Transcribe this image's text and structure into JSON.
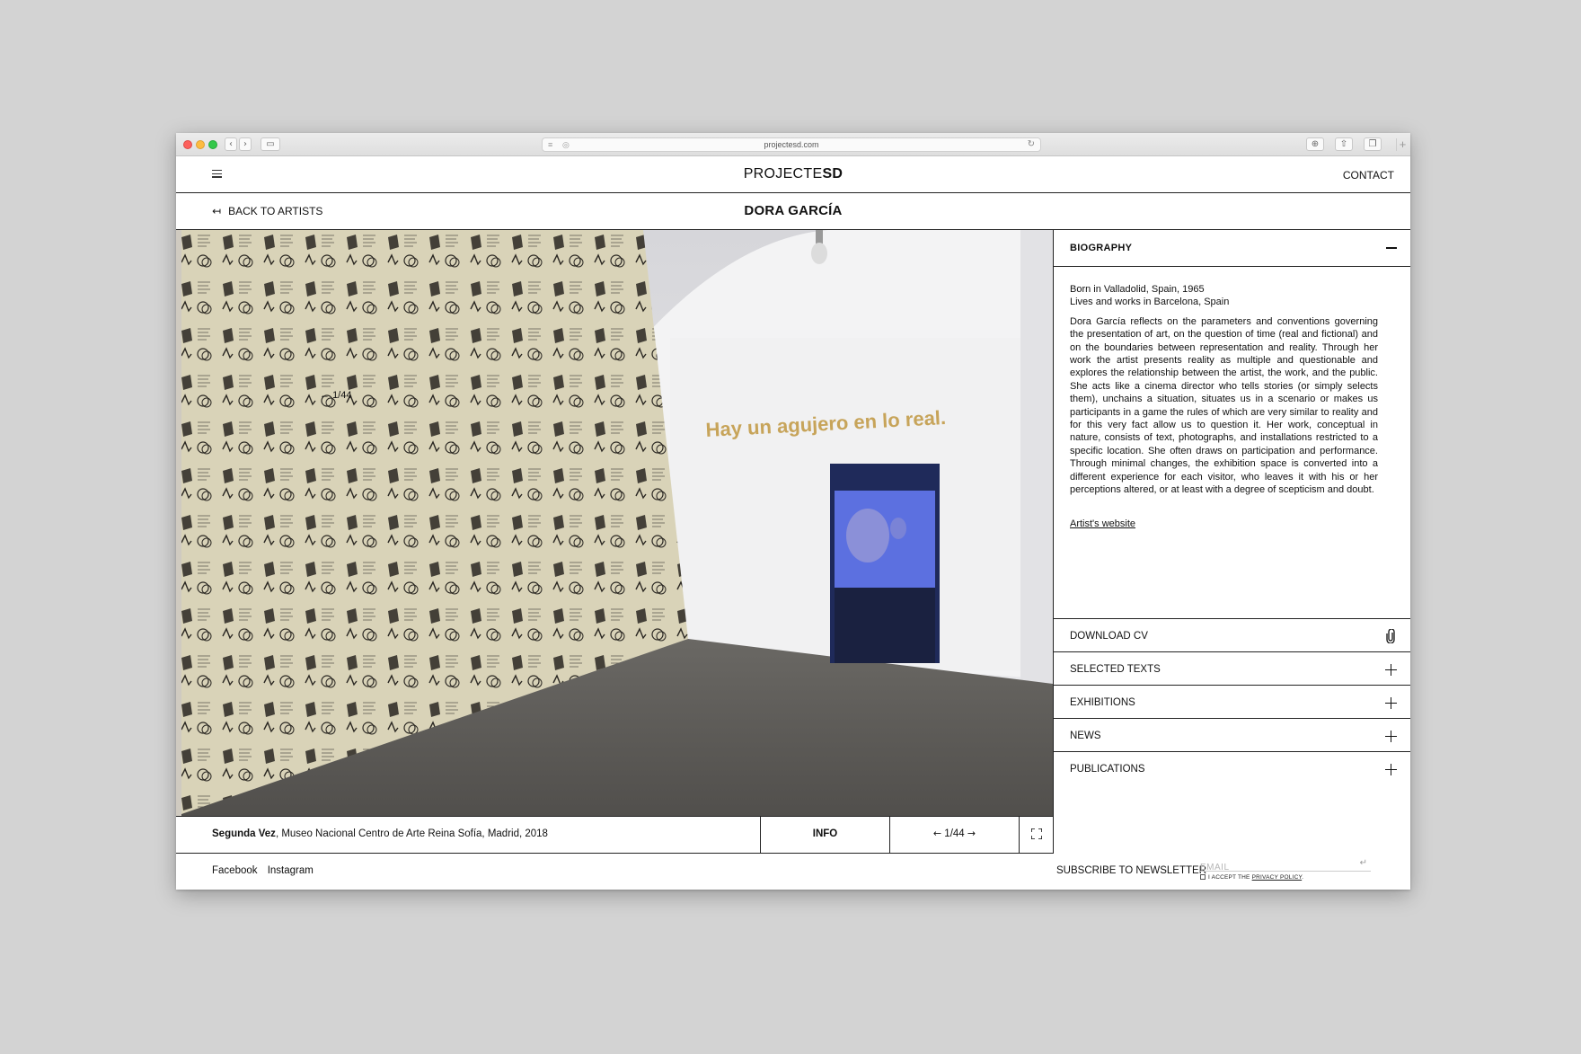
{
  "browser": {
    "url": "projectesd.com"
  },
  "header": {
    "logo_regular": "PROJECTE",
    "logo_bold": "SD",
    "contact": "CONTACT"
  },
  "subheader": {
    "back_label": "BACK TO ARTISTS",
    "artist_name": "DORA GARCÍA"
  },
  "gallery": {
    "overlay_counter": "1/44",
    "wall_text": "Hay un agujero en lo real."
  },
  "caption": {
    "title": "Segunda Vez",
    "rest": ", Museo Nacional Centro de Arte Reina Sofía, Madrid, 2018"
  },
  "controls": {
    "info": "INFO",
    "prev_arrow": "←",
    "counter": "1/44",
    "next_arrow": "→"
  },
  "sidebar": {
    "biography_title": "BIOGRAPHY",
    "born": "Born in Valladolid, Spain, 1965",
    "lives": "Lives and works in Barcelona, Spain",
    "bio_text": "Dora García reflects on the parameters and conventions governing the presentation of art, on the question of time (real and fictional) and on the boundaries between representation and reality. Through her work the artist presents reality as multiple and questionable and explores the relationship between the artist, the work, and the public. She acts like a cinema director who tells stories (or simply selects them), unchains a situation, situates us in a scenario or makes us participants in a game the rules of which are very similar to reality and for this very fact allow us to question it. Her work, conceptual in nature, consists of text, photographs, and installations restricted to a specific location. She often draws on participation and performance. Through minimal changes, the exhibition space is converted into a different experience for each visitor, who leaves it with his or her perceptions altered, or at least with a degree of scepticism and doubt.",
    "website_link": "Artist's website",
    "accordion": [
      {
        "label": "DOWNLOAD CV",
        "icon": "paperclip-icon"
      },
      {
        "label": "SELECTED TEXTS",
        "icon": "plus-icon"
      },
      {
        "label": "EXHIBITIONS",
        "icon": "plus-icon"
      },
      {
        "label": "NEWS",
        "icon": "plus-icon"
      },
      {
        "label": "PUBLICATIONS",
        "icon": "plus-icon"
      }
    ]
  },
  "footer": {
    "facebook": "Facebook",
    "instagram": "Instagram",
    "newsletter_label": "SUBSCRIBE TO NEWSLETTER",
    "email_placeholder": "EMAIL",
    "policy_prefix": "I ACCEPT THE ",
    "policy_link": "PRIVACY POLICY",
    "policy_suffix": "."
  }
}
